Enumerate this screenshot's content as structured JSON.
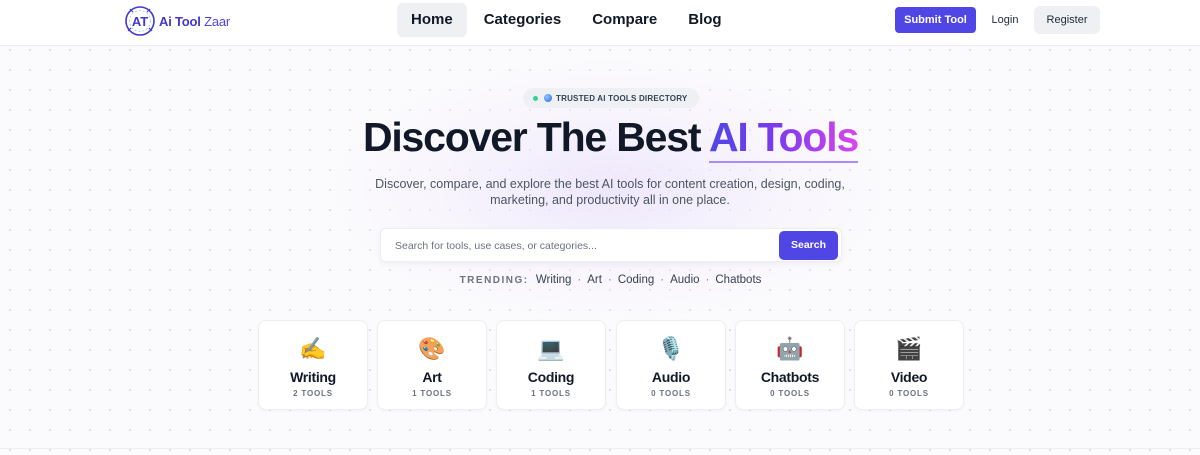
{
  "header": {
    "logo": {
      "brand_main": "Ai Tool",
      "brand_suffix": " Zaar",
      "mark_letters": "AT"
    },
    "nav": [
      {
        "label": "Home",
        "active": true
      },
      {
        "label": "Categories",
        "active": false
      },
      {
        "label": "Compare",
        "active": false
      },
      {
        "label": "Blog",
        "active": false
      }
    ],
    "submit_label": "Submit Tool",
    "login_label": "Login",
    "register_label": "Register"
  },
  "hero": {
    "badge": "TRUSTED AI TOOLS DIRECTORY",
    "title_main": "Discover The Best ",
    "title_accent": "AI Tools",
    "subtitle": "Discover, compare, and explore the best AI tools for content creation, design, coding, marketing, and productivity all in one place."
  },
  "search": {
    "placeholder": "Search for tools, use cases, or categories...",
    "value": "",
    "button_label": "Search"
  },
  "trending": {
    "label": "TRENDING:",
    "tags": [
      "Writing",
      "Art",
      "Coding",
      "Audio",
      "Chatbots"
    ]
  },
  "categories": [
    {
      "name": "Writing",
      "count": "2 TOOLS",
      "icon": "✍️",
      "icon_name": "writing-hand-icon"
    },
    {
      "name": "Art",
      "count": "1 TOOLS",
      "icon": "🎨",
      "icon_name": "palette-icon"
    },
    {
      "name": "Coding",
      "count": "1 TOOLS",
      "icon": "💻",
      "icon_name": "laptop-icon"
    },
    {
      "name": "Audio",
      "count": "0 TOOLS",
      "icon": "🎙️",
      "icon_name": "microphone-icon"
    },
    {
      "name": "Chatbots",
      "count": "0 TOOLS",
      "icon": "🤖",
      "icon_name": "robot-icon"
    },
    {
      "name": "Video",
      "count": "0 TOOLS",
      "icon": "🎬",
      "icon_name": "clapperboard-icon"
    }
  ],
  "colors": {
    "primary": "#4f46e5",
    "accent_gradient": [
      "#4f46e5",
      "#7c3aed",
      "#d946ef"
    ],
    "text": "#111827",
    "muted": "#6b7280"
  }
}
